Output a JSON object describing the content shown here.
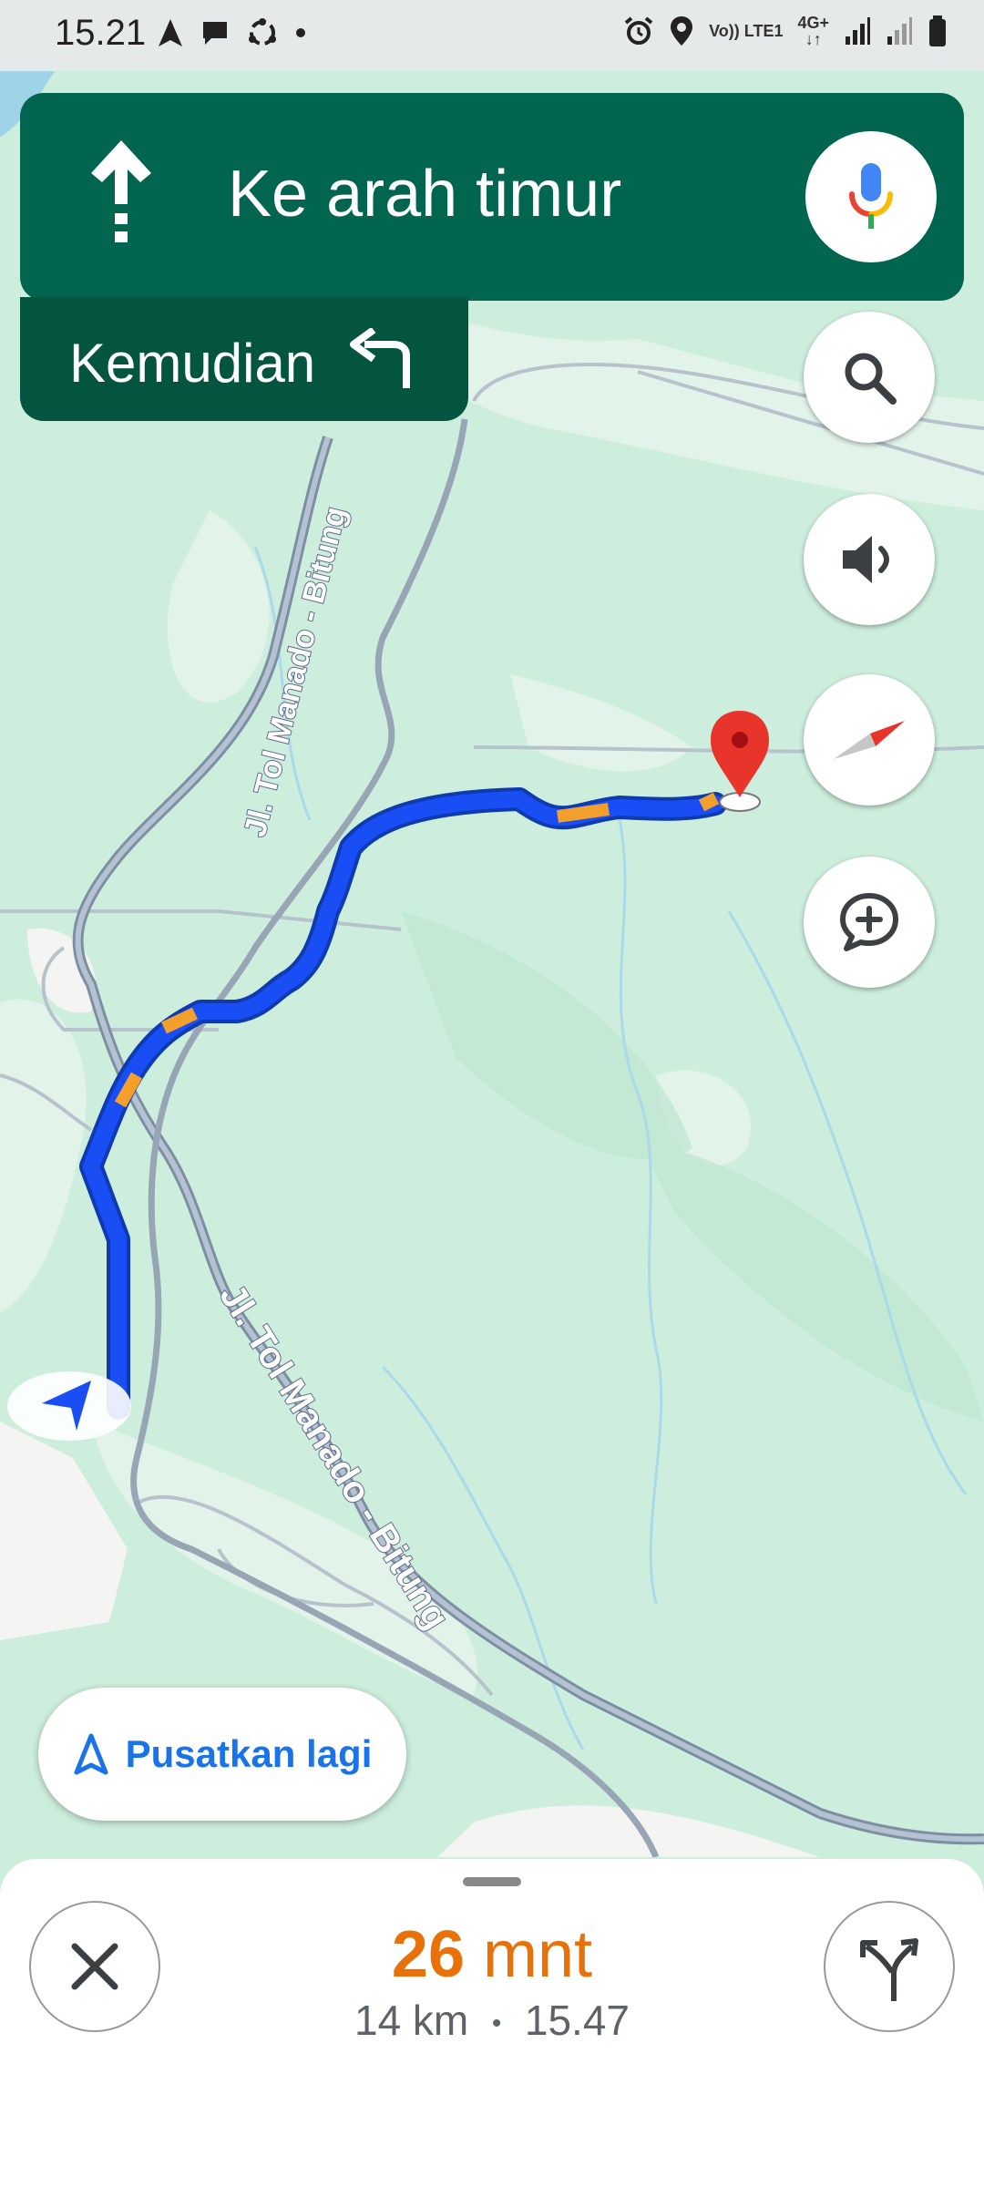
{
  "status_bar": {
    "time": "15.21",
    "net_line1": "Vo)) LTE1",
    "net_line2": "4G+"
  },
  "navigation": {
    "instruction": "Ke arah timur",
    "then_label": "Kemudian"
  },
  "map": {
    "road_label_1": "Jl. Tol Manado - Bitung",
    "road_label_2": "Jl. Tol Manado - Bitung"
  },
  "recenter_label": "Pusatkan lagi",
  "trip": {
    "duration_value": "26",
    "duration_unit": "mnt",
    "distance": "14 km",
    "separator": "•",
    "arrival_time": "15.47"
  }
}
